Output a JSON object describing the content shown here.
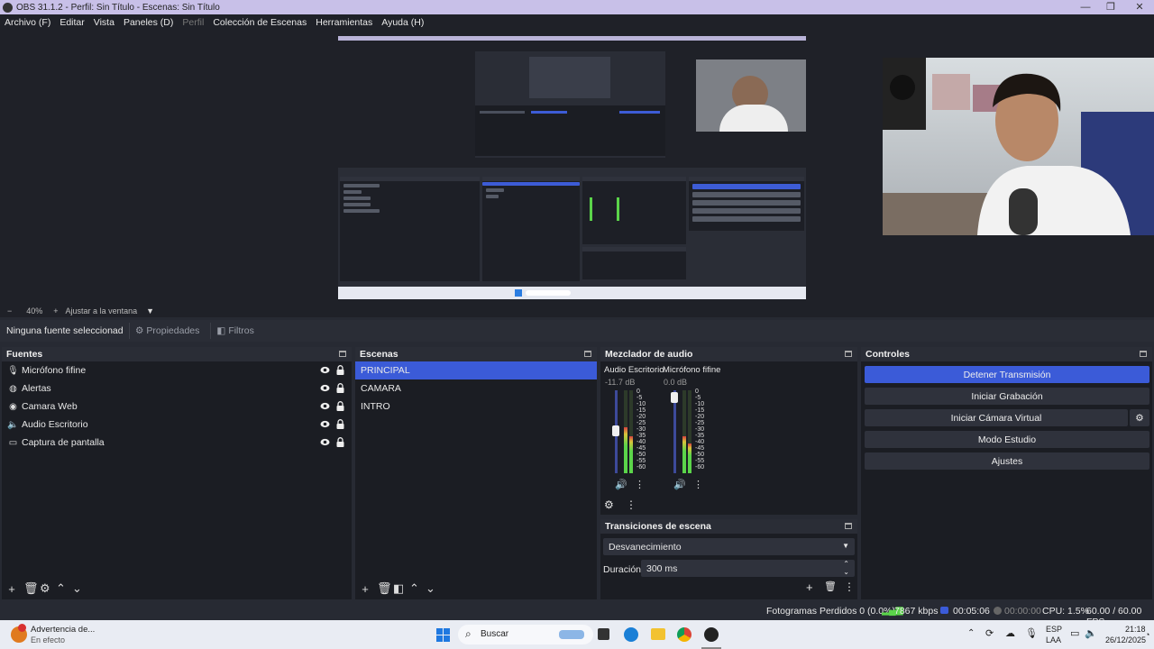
{
  "window": {
    "title": "OBS 31.1.2 - Perfil: Sin Título - Escenas: Sin Título"
  },
  "menu": {
    "items": [
      "Archivo (F)",
      "Editar",
      "Vista",
      "Paneles (D)",
      "Perfil",
      "Colección de Escenas",
      "Herramientas",
      "Ayuda (H)"
    ]
  },
  "zoom": {
    "minus": "−",
    "level": "40%",
    "plus": "+",
    "fit": "Ajustar a la ventana",
    "caret": "▼"
  },
  "source_toolbar": {
    "no_source": "Ninguna fuente seleccionada",
    "properties": "Propiedades",
    "filters": "Filtros"
  },
  "sources": {
    "title": "Fuentes",
    "items": [
      {
        "name": "Micrófono fifine",
        "icon": "microphone-icon"
      },
      {
        "name": "Alertas",
        "icon": "globe-icon"
      },
      {
        "name": "Camara Web",
        "icon": "camera-icon"
      },
      {
        "name": "Audio Escritorio",
        "icon": "speaker-icon"
      },
      {
        "name": "Captura de pantalla",
        "icon": "monitor-icon"
      }
    ]
  },
  "scenes": {
    "title": "Escenas",
    "items": [
      "PRINCIPAL",
      "CAMARA",
      "INTRO"
    ],
    "selected": 0
  },
  "mixer": {
    "title": "Mezclador de audio",
    "channels": [
      {
        "name": "Audio Escritorio",
        "db": "-11.7 dB",
        "level": 0.55,
        "fader": 0.58
      },
      {
        "name": "Micrófono fifine",
        "db": "0.0 dB",
        "level": 0.45,
        "fader": 0.98
      }
    ],
    "scale": [
      "0",
      "-5",
      "-10",
      "-15",
      "-20",
      "-25",
      "-30",
      "-35",
      "-40",
      "-45",
      "-50",
      "-55",
      "-60"
    ]
  },
  "transitions": {
    "title": "Transiciones de escena",
    "type": "Desvanecimiento",
    "duration_label": "Duración",
    "duration": "300 ms"
  },
  "controls": {
    "title": "Controles",
    "buttons": [
      "Detener Transmisión",
      "Iniciar Grabación",
      "Iniciar Cámara Virtual",
      "Modo Estudio",
      "Ajustes"
    ]
  },
  "status": {
    "dropped": "Fotogramas Perdidos 0 (0.0%)",
    "bitrate": "7867 kbps",
    "stream_time": "00:05:06",
    "rec_time": "00:00:00",
    "cpu": "CPU: 1.5%",
    "fps": "60.00 / 60.00 FPS"
  },
  "taskbar": {
    "notif_title": "Advertencia de...",
    "notif_sub": "En efecto",
    "search": "Buscar",
    "lang1": "ESP",
    "lang2": "LAA",
    "time": "21:18",
    "date": "26/12/2025"
  },
  "colors": {
    "accent": "#3b5bd8",
    "meter_green": "#5bd44a",
    "meter_yellow": "#d8c43a",
    "meter_red": "#d84040"
  }
}
